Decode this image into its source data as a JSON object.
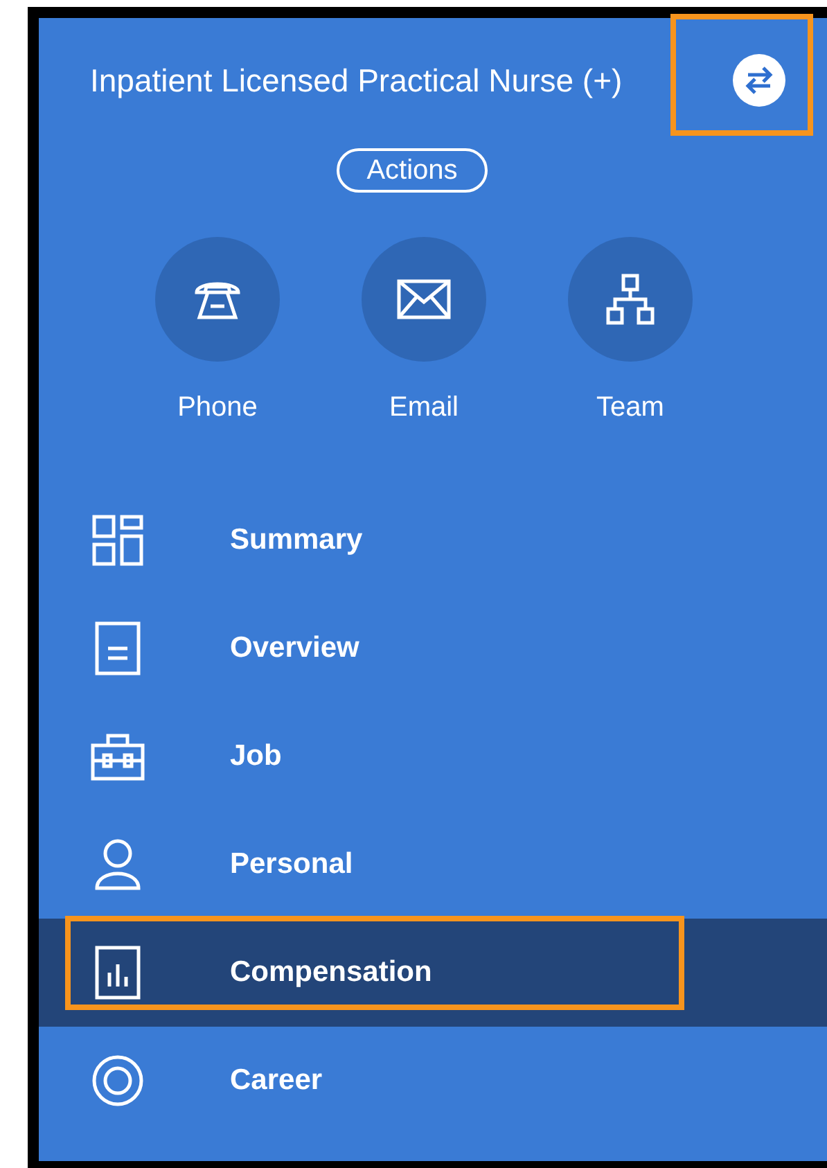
{
  "header": {
    "title": "Inpatient Licensed Practical Nurse (+)",
    "switch_button": {
      "highlighted": true
    }
  },
  "actions_button": "Actions",
  "contact_buttons": [
    {
      "kind": "phone",
      "label": "Phone"
    },
    {
      "kind": "email",
      "label": "Email"
    },
    {
      "kind": "team",
      "label": "Team"
    }
  ],
  "nav_items": [
    {
      "kind": "summary",
      "label": "Summary",
      "selected": false,
      "highlighted": false
    },
    {
      "kind": "overview",
      "label": "Overview",
      "selected": false,
      "highlighted": false
    },
    {
      "kind": "job",
      "label": "Job",
      "selected": false,
      "highlighted": false
    },
    {
      "kind": "personal",
      "label": "Personal",
      "selected": false,
      "highlighted": false
    },
    {
      "kind": "compensation",
      "label": "Compensation",
      "selected": true,
      "highlighted": true
    },
    {
      "kind": "career",
      "label": "Career",
      "selected": false,
      "highlighted": false
    }
  ]
}
